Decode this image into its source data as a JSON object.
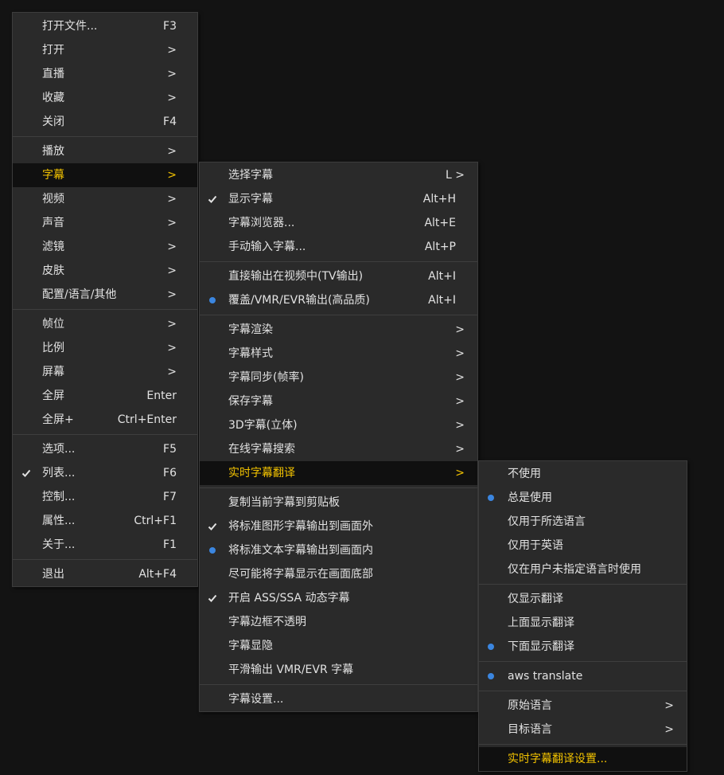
{
  "main_menu": {
    "items": [
      {
        "label": "打开文件...",
        "shortcut": "F3"
      },
      {
        "label": "打开",
        "shortcut": ">"
      },
      {
        "label": "直播",
        "shortcut": ">"
      },
      {
        "label": "收藏",
        "shortcut": ">"
      },
      {
        "label": "关闭",
        "shortcut": "F4"
      },
      {
        "label": "播放",
        "shortcut": ">"
      },
      {
        "label": "字幕",
        "shortcut": ">"
      },
      {
        "label": "视频",
        "shortcut": ">"
      },
      {
        "label": "声音",
        "shortcut": ">"
      },
      {
        "label": "滤镜",
        "shortcut": ">"
      },
      {
        "label": "皮肤",
        "shortcut": ">"
      },
      {
        "label": "配置/语言/其他",
        "shortcut": ">"
      },
      {
        "label": "帧位",
        "shortcut": ">"
      },
      {
        "label": "比例",
        "shortcut": ">"
      },
      {
        "label": "屏幕",
        "shortcut": ">"
      },
      {
        "label": "全屏",
        "shortcut": "Enter"
      },
      {
        "label": "全屏+",
        "shortcut": "Ctrl+Enter"
      },
      {
        "label": "选项...",
        "shortcut": "F5"
      },
      {
        "label": "列表...",
        "shortcut": "F6"
      },
      {
        "label": "控制...",
        "shortcut": "F7"
      },
      {
        "label": "属性...",
        "shortcut": "Ctrl+F1"
      },
      {
        "label": "关于...",
        "shortcut": "F1"
      },
      {
        "label": "退出",
        "shortcut": "Alt+F4"
      }
    ]
  },
  "subtitle_menu": {
    "items": [
      {
        "label": "选择字幕",
        "shortcut": "L >"
      },
      {
        "label": "显示字幕",
        "shortcut": "Alt+H"
      },
      {
        "label": "字幕浏览器...",
        "shortcut": "Alt+E"
      },
      {
        "label": "手动输入字幕...",
        "shortcut": "Alt+P"
      },
      {
        "label": "直接输出在视频中(TV输出)",
        "shortcut": "Alt+I"
      },
      {
        "label": "覆盖/VMR/EVR输出(高品质)",
        "shortcut": "Alt+I"
      },
      {
        "label": "字幕渲染",
        "shortcut": ">"
      },
      {
        "label": "字幕样式",
        "shortcut": ">"
      },
      {
        "label": "字幕同步(帧率)",
        "shortcut": ">"
      },
      {
        "label": "保存字幕",
        "shortcut": ">"
      },
      {
        "label": "3D字幕(立体)",
        "shortcut": ">"
      },
      {
        "label": "在线字幕搜索",
        "shortcut": ">"
      },
      {
        "label": "实时字幕翻译",
        "shortcut": ">"
      },
      {
        "label": "复制当前字幕到剪贴板",
        "shortcut": ""
      },
      {
        "label": "将标准图形字幕输出到画面外",
        "shortcut": ""
      },
      {
        "label": "将标准文本字幕输出到画面内",
        "shortcut": ""
      },
      {
        "label": "尽可能将字幕显示在画面底部",
        "shortcut": ""
      },
      {
        "label": "开启 ASS/SSA 动态字幕",
        "shortcut": ""
      },
      {
        "label": "字幕边框不透明",
        "shortcut": ""
      },
      {
        "label": "字幕显隐",
        "shortcut": ""
      },
      {
        "label": "平滑输出 VMR/EVR 字幕",
        "shortcut": ""
      },
      {
        "label": "字幕设置...",
        "shortcut": ""
      }
    ]
  },
  "translate_menu": {
    "items": [
      {
        "label": "不使用",
        "shortcut": ""
      },
      {
        "label": "总是使用",
        "shortcut": ""
      },
      {
        "label": "仅用于所选语言",
        "shortcut": ""
      },
      {
        "label": "仅用于英语",
        "shortcut": ""
      },
      {
        "label": "仅在用户未指定语言时使用",
        "shortcut": ""
      },
      {
        "label": "仅显示翻译",
        "shortcut": ""
      },
      {
        "label": "上面显示翻译",
        "shortcut": ""
      },
      {
        "label": "下面显示翻译",
        "shortcut": ""
      },
      {
        "label": "aws translate",
        "shortcut": ""
      },
      {
        "label": "原始语言",
        "shortcut": ">"
      },
      {
        "label": "目标语言",
        "shortcut": ">"
      },
      {
        "label": "实时字幕翻译设置...",
        "shortcut": ""
      }
    ]
  },
  "colors": {
    "highlight_text": "#f3c300",
    "radio": "#3b86e0",
    "menu_bg": "#2a2a2a"
  }
}
